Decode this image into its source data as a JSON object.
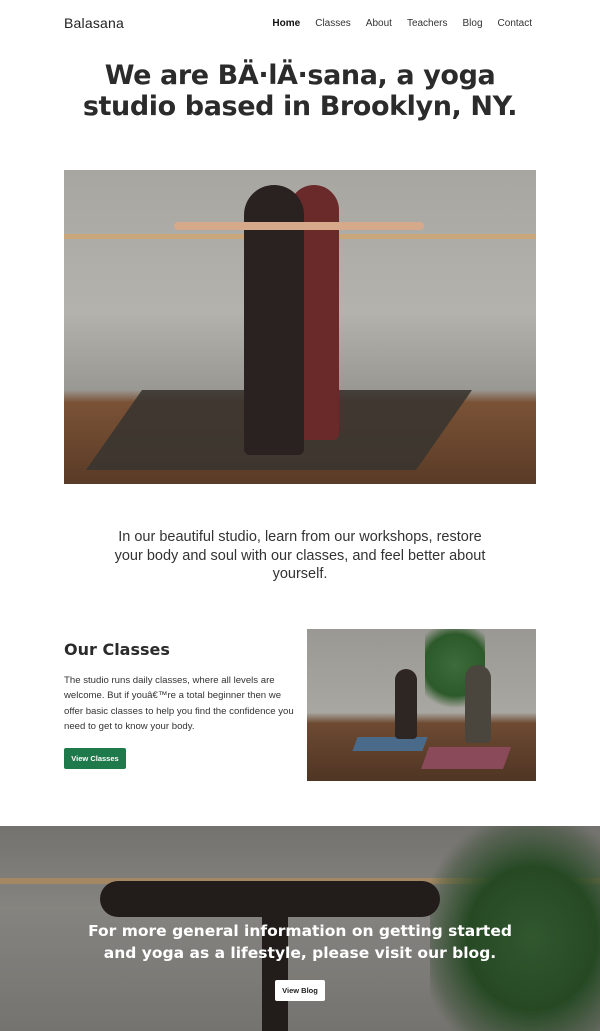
{
  "header": {
    "brand": "Balasana",
    "nav": [
      {
        "label": "Home",
        "active": true
      },
      {
        "label": "Classes",
        "active": false
      },
      {
        "label": "About",
        "active": false
      },
      {
        "label": "Teachers",
        "active": false
      },
      {
        "label": "Blog",
        "active": false
      },
      {
        "label": "Contact",
        "active": false
      }
    ]
  },
  "hero": {
    "title_line1": "We are BÄ·lÄ·sana, a yoga",
    "title_line2": "studio based in Brooklyn, NY."
  },
  "intro": {
    "text": "In our beautiful studio, learn from our workshops, restore your body and soul with our classes, and feel better about yourself."
  },
  "classes": {
    "title": "Our Classes",
    "body": "The studio runs daily classes, where all levels are welcome. But if youâ€™re a total beginner then we offer basic classes to help you find the confidence you need to get to know your body.",
    "button_label": "View Classes"
  },
  "banner": {
    "text_line1": "For more general information on getting started",
    "text_line2": "and yoga as a lifestyle, please visit our blog.",
    "button_label": "View Blog"
  },
  "colors": {
    "accent_green": "#1e7a4a",
    "text_dark": "#2b2b2b"
  }
}
